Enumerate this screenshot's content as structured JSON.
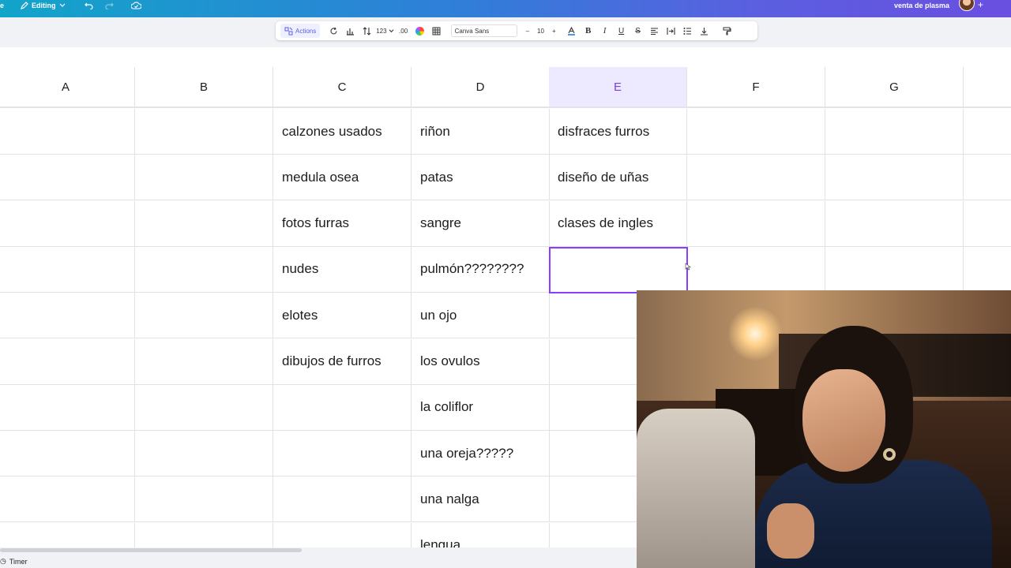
{
  "topbar": {
    "left_cut_text": "e",
    "editing_label": "Editing",
    "project_title": "venta de plasma",
    "plus_label": "+"
  },
  "toolbar": {
    "actions_label": "Actions",
    "number_format_label": "123",
    "decimals_label": ".00",
    "font_name": "Canva Sans",
    "font_size": "10",
    "minus_label": "–",
    "plus_label": "+",
    "bold_label": "B",
    "italic_label": "I",
    "underline_label": "U",
    "strike_label": "S"
  },
  "sheet": {
    "columns": [
      "A",
      "B",
      "C",
      "D",
      "E",
      "F",
      "G"
    ],
    "selected_column": "E",
    "rows": [
      [
        "",
        "",
        "calzones usados",
        "riñon",
        "disfraces furros",
        "",
        ""
      ],
      [
        "",
        "",
        "medula osea",
        "patas",
        "diseño de uñas",
        "",
        ""
      ],
      [
        "",
        "",
        "fotos furras",
        "sangre",
        "clases de ingles",
        "",
        ""
      ],
      [
        "",
        "",
        "nudes",
        "pulmón????????",
        "",
        "",
        ""
      ],
      [
        "",
        "",
        "elotes",
        "un ojo",
        "",
        "",
        ""
      ],
      [
        "",
        "",
        "dibujos de furros",
        "los ovulos",
        "",
        "",
        ""
      ],
      [
        "",
        "",
        "",
        "la coliflor",
        "",
        "",
        ""
      ],
      [
        "",
        "",
        "",
        "una oreja?????",
        "",
        "",
        ""
      ],
      [
        "",
        "",
        "",
        "una nalga",
        "",
        "",
        ""
      ],
      [
        "",
        "",
        "",
        "lengua",
        "",
        "",
        ""
      ]
    ]
  },
  "bottombar": {
    "timer_label": "Timer"
  },
  "colors": {
    "accent": "#8b3dff",
    "selected_header_bg": "#ede9ff"
  }
}
